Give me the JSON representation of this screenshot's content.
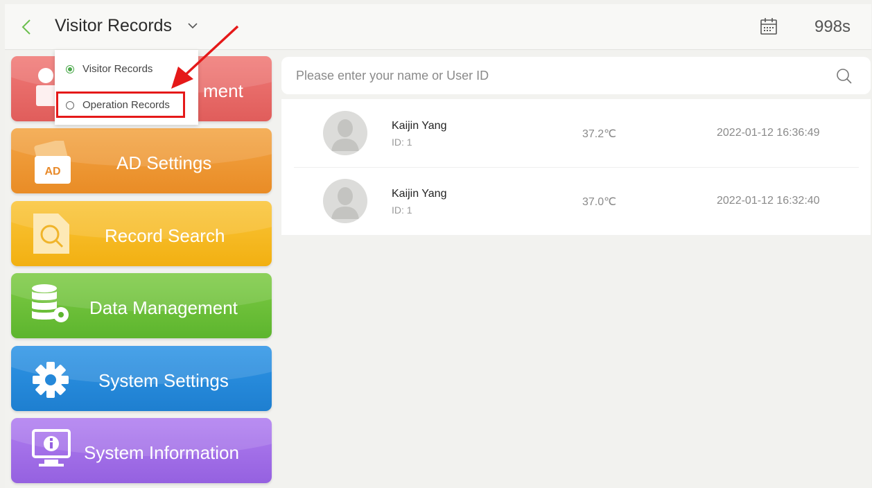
{
  "header": {
    "title": "Visitor Records",
    "timer": "998s"
  },
  "dropdown": {
    "options": [
      {
        "label": "Visitor Records",
        "selected": true
      },
      {
        "label": "Operation Records",
        "selected": false
      }
    ]
  },
  "sidebar": {
    "items": [
      {
        "label": "User Management",
        "visible_label": "ment",
        "color": "#e8605f"
      },
      {
        "label": "AD Settings",
        "icon_text": "AD",
        "color": "#ee9a34"
      },
      {
        "label": "Record Search",
        "color": "#f7bc20"
      },
      {
        "label": "Data Management",
        "color": "#6cbf37"
      },
      {
        "label": "System Settings",
        "color": "#2588d9"
      },
      {
        "label": "System Information",
        "color": "#a06ee8"
      }
    ]
  },
  "search": {
    "placeholder": "Please enter your name or User ID"
  },
  "records": [
    {
      "name": "Kaijin Yang",
      "id": "ID: 1",
      "temperature": "37.2℃",
      "time": "2022-01-12 16:36:49"
    },
    {
      "name": "Kaijin Yang",
      "id": "ID: 1",
      "temperature": "37.0℃",
      "time": "2022-01-12 16:32:40"
    }
  ],
  "colors": {
    "accent_green": "#4aa84a",
    "highlight_red": "#e51919"
  }
}
